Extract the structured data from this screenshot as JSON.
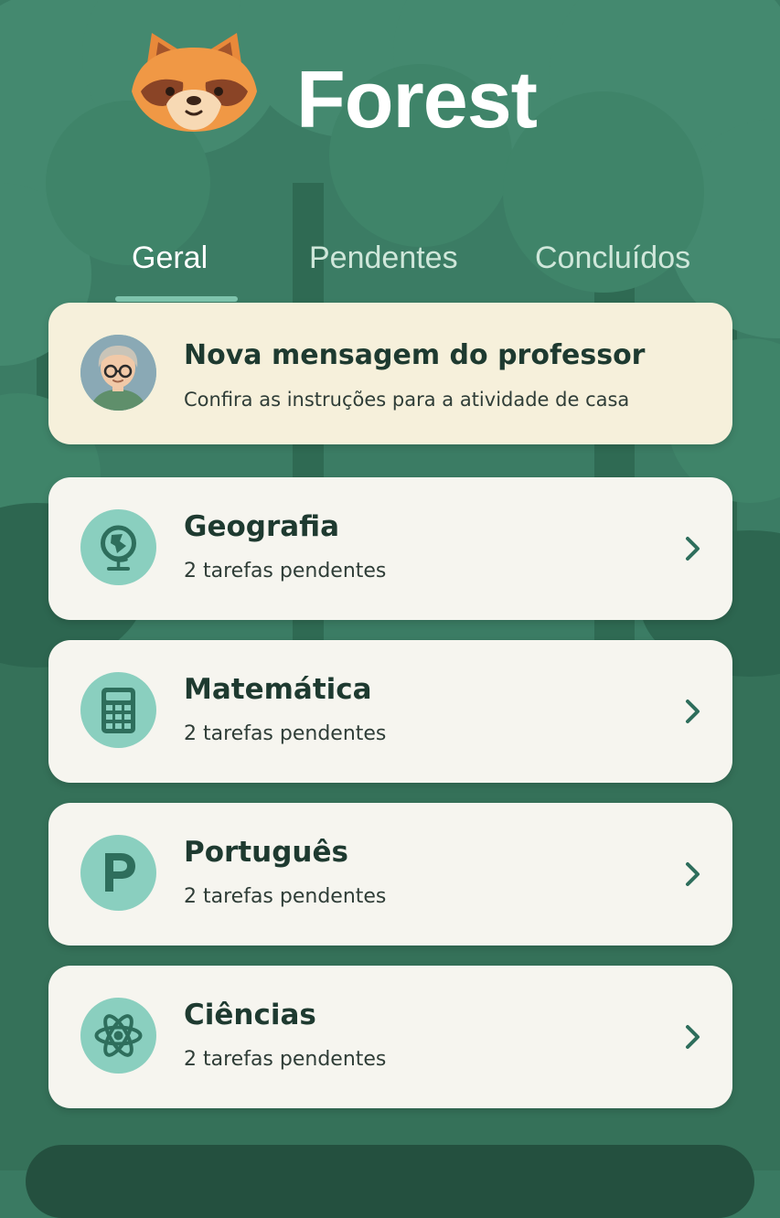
{
  "app": {
    "title": "Forest"
  },
  "tabs": [
    {
      "label": "Geral",
      "active": true
    },
    {
      "label": "Pendentes",
      "active": false
    },
    {
      "label": "Concluídos",
      "active": false
    }
  ],
  "message_card": {
    "title": "Nova mensagem do professor",
    "subtitle": "Confira as instruções para a atividade de casa",
    "icon": "teacher-avatar"
  },
  "subjects": [
    {
      "title": "Geografia",
      "subtitle": "2 tarefas pendentes",
      "icon": "globe-icon"
    },
    {
      "title": "Matemática",
      "subtitle": "2 tarefas pendentes",
      "icon": "calculator-icon"
    },
    {
      "title": "Português",
      "subtitle": "2 tarefas pendentes",
      "icon": "letter-p-icon"
    },
    {
      "title": "Ciências",
      "subtitle": "2 tarefas pendentes",
      "icon": "atom-icon"
    }
  ],
  "colors": {
    "background": "#3a7a62",
    "card": "#f6f5ef",
    "message_card": "#f6f0db",
    "icon_circle": "#8acfbf",
    "icon_glyph": "#2e6e5c",
    "text_dark": "#1e3a30"
  }
}
